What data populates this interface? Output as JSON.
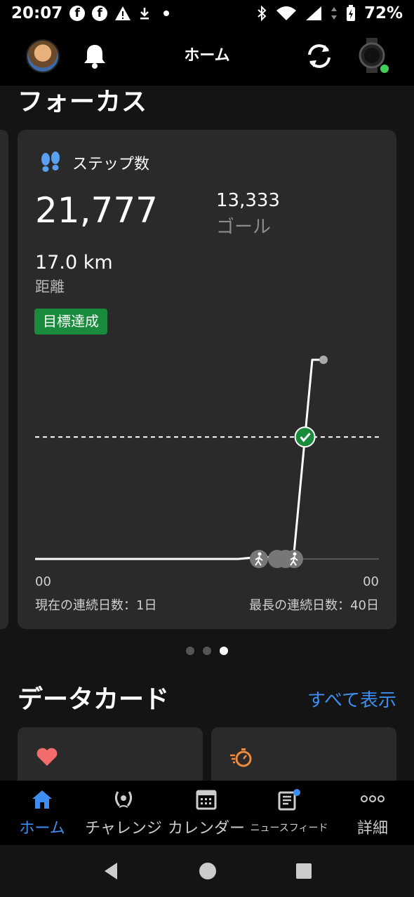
{
  "status_bar": {
    "time": "20:07",
    "battery": "72%"
  },
  "header": {
    "title": "ホーム"
  },
  "focus": {
    "section_title": "フォーカス",
    "card": {
      "label": "ステップ数",
      "steps": "21,777",
      "goal_value": "13,333",
      "goal_label": "ゴール",
      "distance_value": "17.0 km",
      "distance_label": "距離",
      "badge": "目標達成",
      "tick_start": "00",
      "tick_end": "00",
      "current_streak": "現在の連続日数：1日",
      "longest_streak": "最長の連続日数：40日"
    },
    "chart_data": {
      "type": "line",
      "series": [
        {
          "values": [
            0,
            0,
            0,
            0,
            0,
            0,
            0,
            0,
            0,
            0,
            0,
            0,
            200,
            200,
            400,
            21777
          ]
        }
      ],
      "goal_line": 13333,
      "final_value": 21777
    },
    "pager": {
      "count": 3,
      "active_index": 2
    }
  },
  "data_cards": {
    "section_title": "データカード",
    "see_all": "すべて表示"
  },
  "bottom_nav": {
    "items": [
      {
        "label": "ホーム",
        "icon": "home-icon",
        "active": true
      },
      {
        "label": "チャレンジ",
        "icon": "laurel-icon"
      },
      {
        "label": "カレンダー",
        "icon": "calendar-icon"
      },
      {
        "label": "ニュースフィード",
        "icon": "newsfeed-icon"
      },
      {
        "label": "詳細",
        "icon": "more-icon"
      }
    ]
  },
  "colors": {
    "accent": "#3d8ef0",
    "goal_badge": "#1a8b3c",
    "steps_icon": "#5aa0f0",
    "heart": "#f26c6c",
    "activity": "#f08a3c"
  }
}
